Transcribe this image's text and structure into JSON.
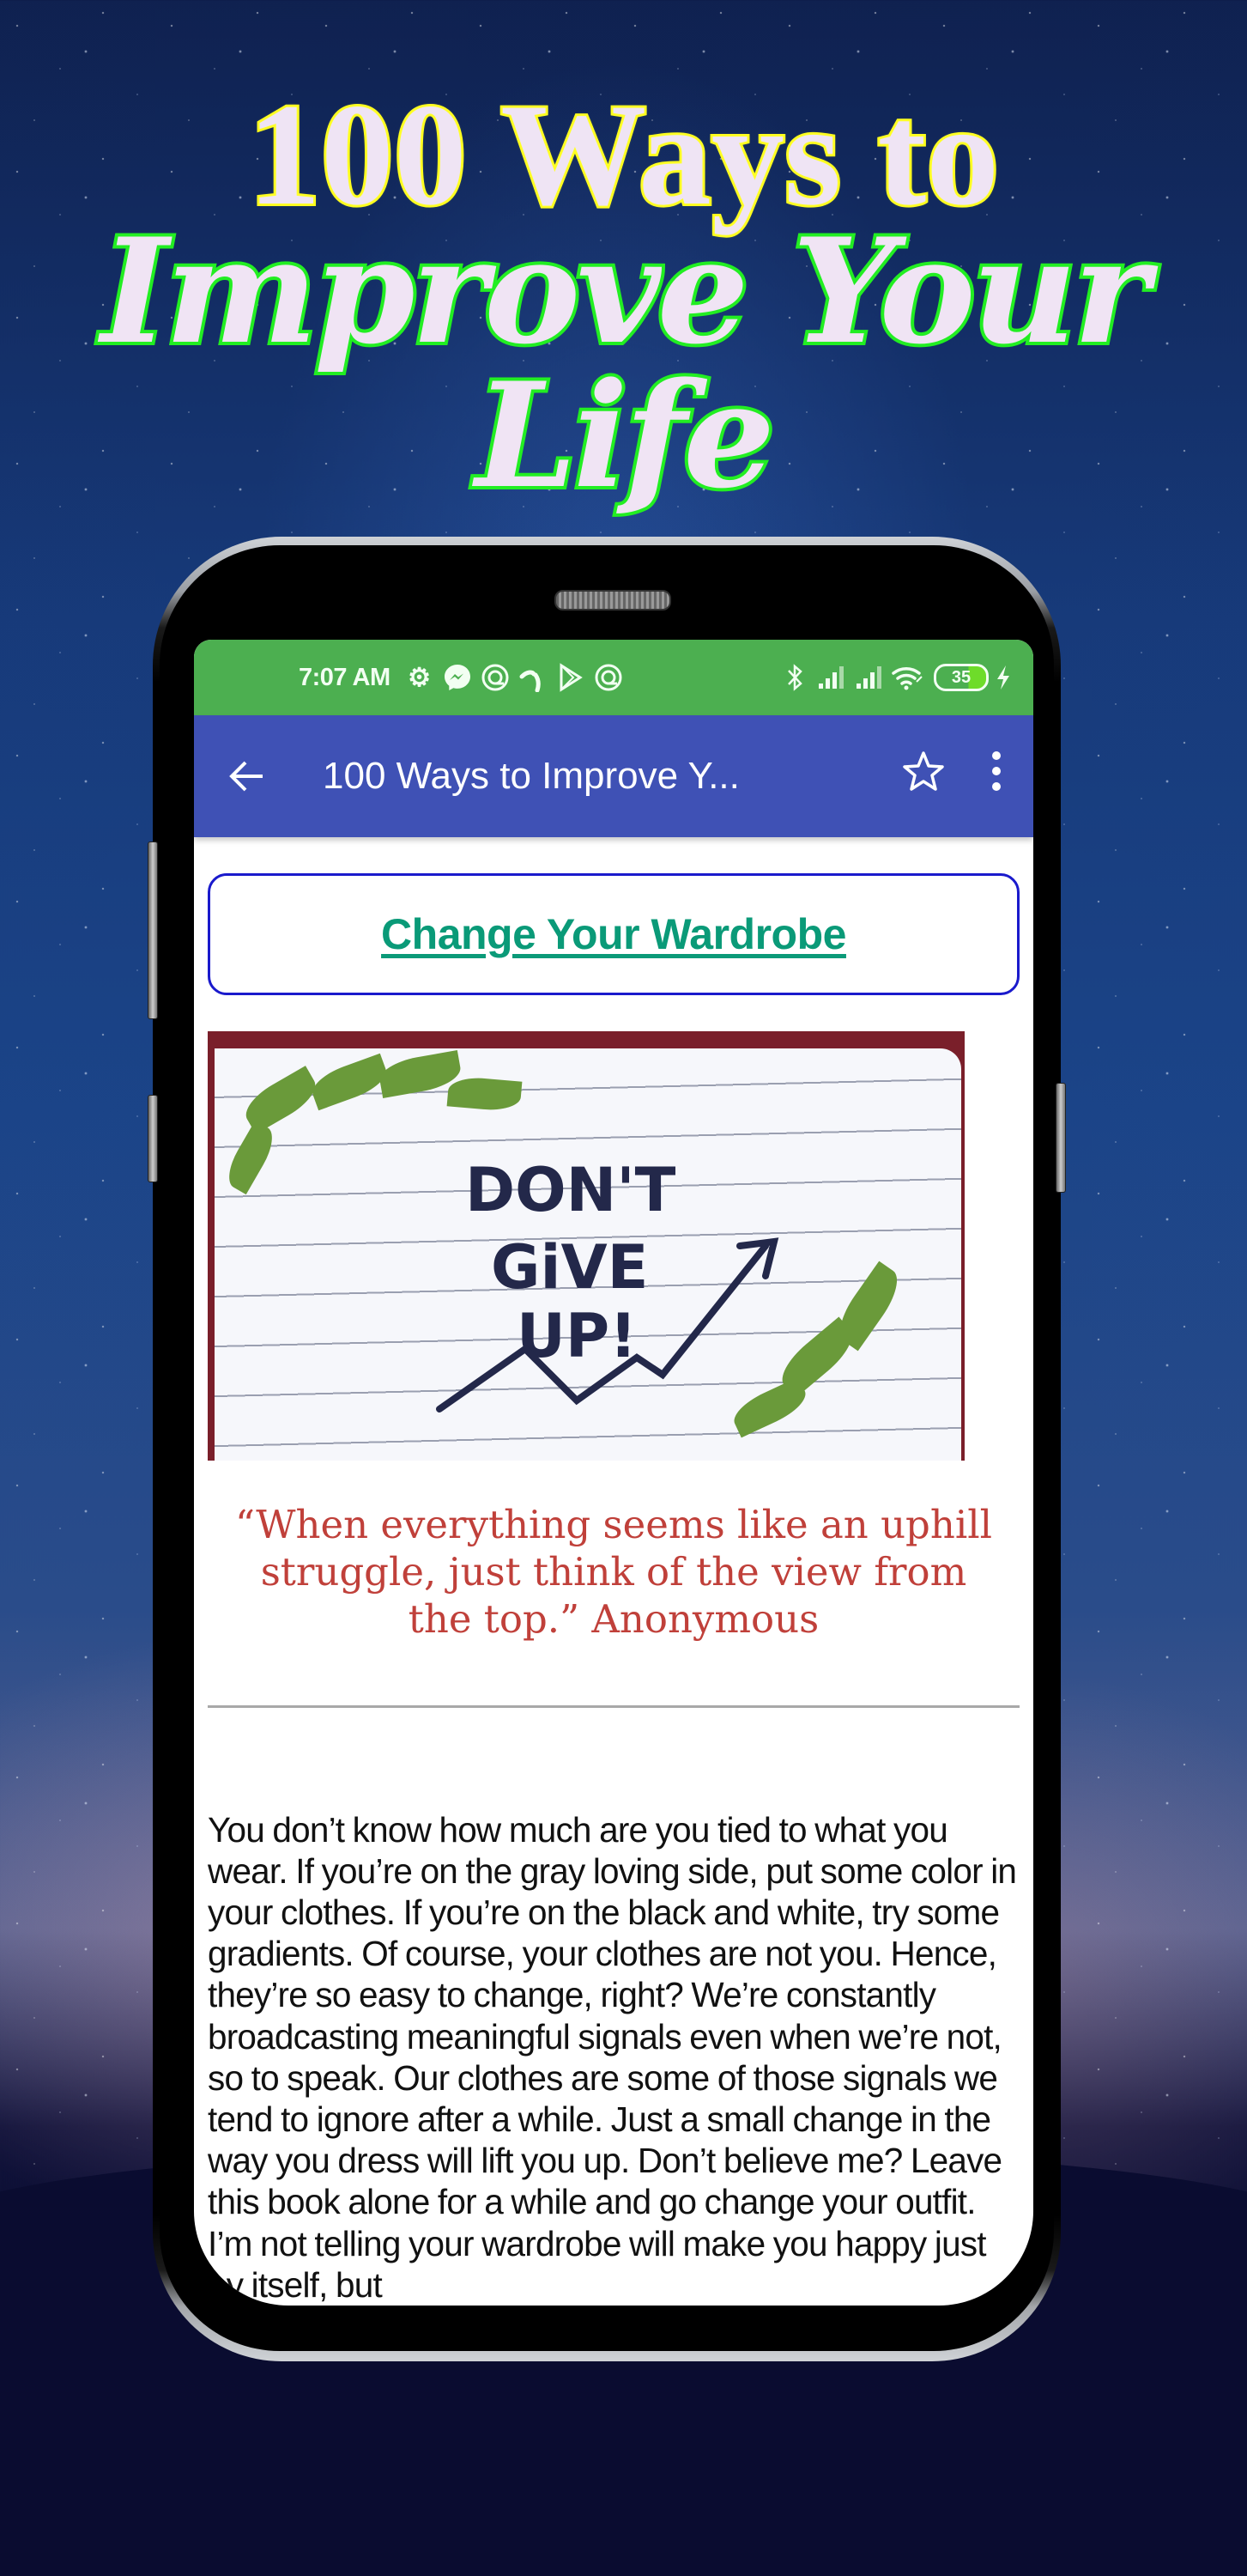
{
  "promo": {
    "line1": "100 Ways to",
    "line2": "Improve Your Life"
  },
  "status_bar": {
    "time": "7:07 AM",
    "left_icons": [
      "gear-icon",
      "messenger-icon",
      "at-sign-icon",
      "telenor-icon",
      "play-store-icon",
      "at-sign-icon"
    ],
    "right_icons": [
      "bluetooth-icon",
      "signal-icon",
      "signal-icon",
      "wifi-icon"
    ],
    "battery_level": "35",
    "charging": true
  },
  "app_bar": {
    "title": "100 Ways to Improve Y...",
    "back_icon": "arrow-left-icon",
    "favorite_icon": "star-outline-icon",
    "more_icon": "more-vertical-icon"
  },
  "article": {
    "heading": "Change Your Wardrobe",
    "image_text": [
      "DON'T",
      "GiVE",
      "UP!"
    ],
    "quote": "“When everything seems like an uphill struggle, just think of the view from the top.” Anonymous",
    "body": "You don’t know how much are you tied to what you wear. If you’re on the gray loving side, put some color in your clothes. If you’re on the black and white, try some gradients. Of course, your clothes are not you. Hence, they’re so easy to change, right? We’re constantly broadcasting meaningful signals even when we’re not, so to speak. Our clothes are some of those signals we tend to ignore after a while. Just a small change in the way you dress will lift you up. Don’t believe me? Leave this book alone for a while and go change your outfit. I’m not telling your wardrobe will make you happy just by itself, but"
  },
  "colors": {
    "status_bar": "#4caf50",
    "app_bar": "#3f51b5",
    "heading": "#0a9a78",
    "heading_border": "#1a1acc",
    "quote": "#c0403a"
  }
}
